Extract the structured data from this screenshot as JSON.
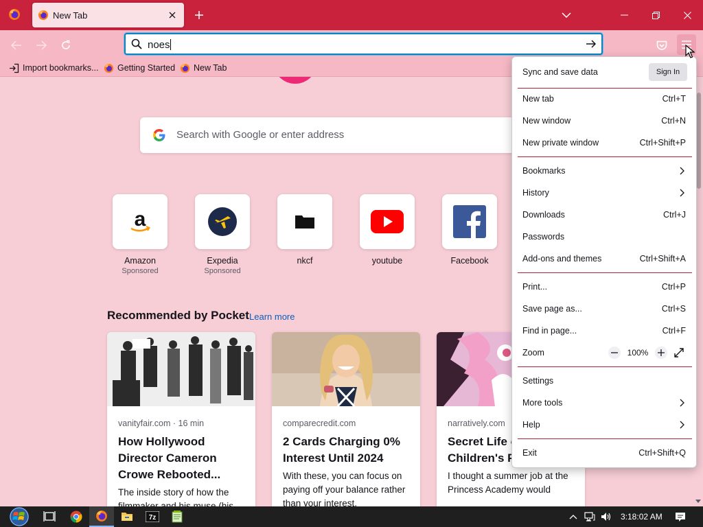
{
  "window": {
    "tab_title": "New Tab",
    "new_tab_label": "+"
  },
  "navbar": {
    "url_value": "noes"
  },
  "bookmarks_toolbar": {
    "items": [
      {
        "label": "Import bookmarks...",
        "icon": "import-icon"
      },
      {
        "label": "Getting Started",
        "icon": "firefox-icon"
      },
      {
        "label": "New Tab",
        "icon": "firefox-icon"
      }
    ]
  },
  "newtab": {
    "search_placeholder": "Search with Google or enter address",
    "top_sites": [
      {
        "name": "Amazon",
        "sub": "Sponsored",
        "icon": "amazon-icon"
      },
      {
        "name": "Expedia",
        "sub": "Sponsored",
        "icon": "expedia-icon"
      },
      {
        "name": "nkcf",
        "sub": "",
        "icon": "folder-icon"
      },
      {
        "name": "youtube",
        "sub": "",
        "icon": "youtube-icon"
      },
      {
        "name": "Facebook",
        "sub": "",
        "icon": "facebook-icon"
      }
    ],
    "pocket": {
      "heading": "Recommended by Pocket",
      "learn_more": "Learn more",
      "cards": [
        {
          "source": "vanityfair.com · 16 min",
          "title": "How Hollywood Director Cameron Crowe Rebooted...",
          "excerpt": "The inside story of how the filmmaker and his muse (his"
        },
        {
          "source": "comparecredit.com",
          "title": "2 Cards Charging 0% Interest Until 2024",
          "excerpt": "With these, you can focus on paying off your balance rather than your interest."
        },
        {
          "source": "narratively.com",
          "title": "Secret Life o Children's Pa Princess",
          "excerpt": "I thought a summer job at the Princess Academy would"
        }
      ]
    }
  },
  "app_menu": {
    "sync_label": "Sync and save data",
    "sign_in": "Sign In",
    "items": {
      "new_tab": {
        "label": "New tab",
        "shortcut": "Ctrl+T"
      },
      "new_window": {
        "label": "New window",
        "shortcut": "Ctrl+N"
      },
      "new_private": {
        "label": "New private window",
        "shortcut": "Ctrl+Shift+P"
      },
      "bookmarks": {
        "label": "Bookmarks"
      },
      "history": {
        "label": "History"
      },
      "downloads": {
        "label": "Downloads",
        "shortcut": "Ctrl+J"
      },
      "passwords": {
        "label": "Passwords"
      },
      "addons": {
        "label": "Add-ons and themes",
        "shortcut": "Ctrl+Shift+A"
      },
      "print": {
        "label": "Print...",
        "shortcut": "Ctrl+P"
      },
      "save_page": {
        "label": "Save page as...",
        "shortcut": "Ctrl+S"
      },
      "find": {
        "label": "Find in page...",
        "shortcut": "Ctrl+F"
      },
      "zoom": {
        "label": "Zoom",
        "value": "100%"
      },
      "settings": {
        "label": "Settings"
      },
      "more_tools": {
        "label": "More tools"
      },
      "help": {
        "label": "Help"
      },
      "exit": {
        "label": "Exit",
        "shortcut": "Ctrl+Shift+Q"
      }
    }
  },
  "taskbar": {
    "clock": "3:18:02 AM"
  },
  "colors": {
    "titlebar": "#c8223d",
    "toolbar": "#f6b8c5",
    "content_bg": "#f7cdd6",
    "menu_separator": "#b42033",
    "accent_focus": "#0a84c4"
  }
}
